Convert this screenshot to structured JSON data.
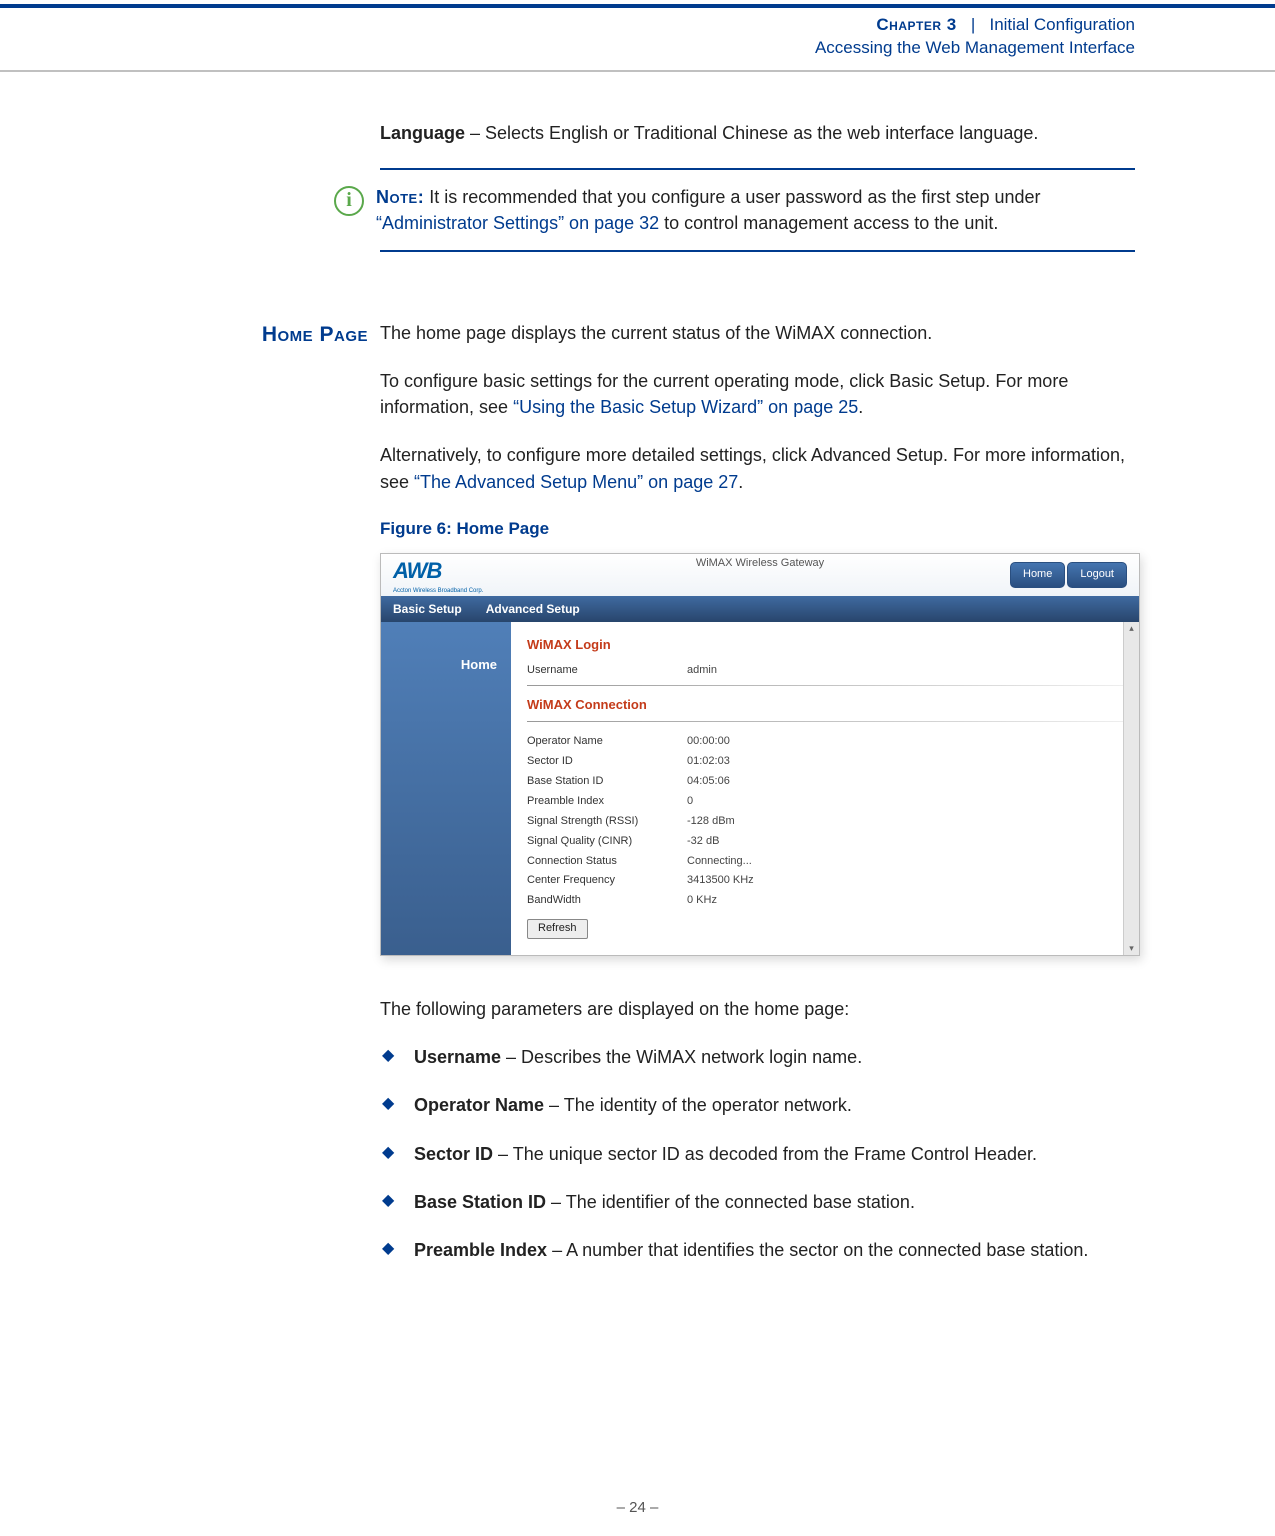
{
  "header": {
    "chapter": "Chapter 3",
    "sep": "|",
    "title1": "Initial Configuration",
    "title2": "Accessing the Web Management Interface"
  },
  "language": {
    "label": "Language",
    "desc": " – Selects English or Traditional Chinese as the web interface language."
  },
  "note": {
    "label": "Note:",
    "text_before": " It is recommended that you configure a user password as the first step under ",
    "link": "“Administrator Settings” on page 32",
    "text_after": " to control management access to the unit."
  },
  "home_section_label": "Home Page",
  "home_p1": "The home page displays the current status of the WiMAX connection.",
  "home_p2a": "To configure basic settings for the current operating mode, click Basic Setup. For more information, see ",
  "home_p2_link": "“Using the Basic Setup Wizard” on page 25",
  "home_p2b": ".",
  "home_p3a": "Alternatively, to configure more detailed settings, click Advanced Setup. For more information, see ",
  "home_p3_link": "“The Advanced Setup Menu” on page 27",
  "home_p3b": ".",
  "figure_caption": "Figure 6:  Home Page",
  "screenshot": {
    "logo_mark": "AWB",
    "logo_sub": "Accton Wireless Broadband Corp.",
    "title": "WiMAX Wireless Gateway",
    "btn_home not visible": "",
    "btn_home": "Home",
    "btn_logout": "Logout",
    "tab_basic": "Basic Setup",
    "tab_advanced": "Advanced Setup",
    "sidebar_home": "Home",
    "sec_login": "WiMAX Login",
    "login_k": "Username",
    "login_v": "admin",
    "sec_conn": "WiMAX Connection",
    "rows": [
      {
        "k": "Operator Name",
        "v": "00:00:00"
      },
      {
        "k": "Sector ID",
        "v": "01:02:03"
      },
      {
        "k": "Base Station ID",
        "v": "04:05:06"
      },
      {
        "k": "Preamble Index",
        "v": "0"
      },
      {
        "k": "Signal Strength (RSSI)",
        "v": "-128 dBm"
      },
      {
        "k": "Signal Quality (CINR)",
        "v": "-32 dB"
      },
      {
        "k": "Connection Status",
        "v": "Connecting..."
      },
      {
        "k": "Center Frequency",
        "v": "3413500 KHz"
      },
      {
        "k": "BandWidth",
        "v": "0 KHz"
      }
    ],
    "refresh": "Refresh"
  },
  "params_intro": "The following parameters are displayed on the home page:",
  "params": [
    {
      "label": "Username",
      "desc": " – Describes the WiMAX network login name."
    },
    {
      "label": "Operator Name",
      "desc": " – The identity of the operator network."
    },
    {
      "label": "Sector ID",
      "desc": " – The unique sector ID as decoded from the Frame Control Header."
    },
    {
      "label": "Base Station ID",
      "desc": " – The identifier of the connected base station."
    },
    {
      "label": "Preamble Index",
      "desc": " – A number that identifies the sector on the connected base station."
    }
  ],
  "footer": "–  24  –"
}
